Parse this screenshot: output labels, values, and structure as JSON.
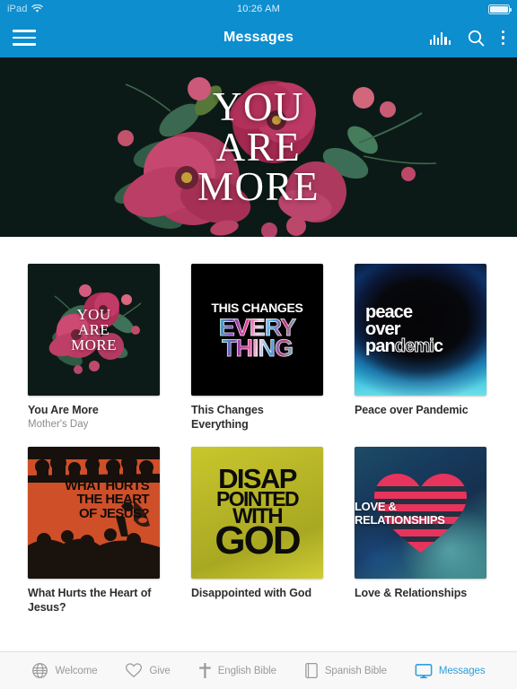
{
  "statusbar": {
    "device": "iPad",
    "wifi_icon": "wifi-icon",
    "time": "10:26 AM",
    "battery_icon": "battery-full-icon"
  },
  "navbar": {
    "menu_icon": "hamburger-menu-icon",
    "title": "Messages",
    "actions": [
      {
        "name": "audio-equalizer-icon",
        "label": "Audio"
      },
      {
        "name": "search-icon",
        "label": "Search"
      },
      {
        "name": "overflow-menu-icon",
        "label": "More"
      }
    ]
  },
  "hero": {
    "line1": "YOU",
    "line2": "ARE",
    "line3": "MORE",
    "background_color": "#0d1b18",
    "accent_color": "#c42a63"
  },
  "series": [
    {
      "title": "You Are More",
      "subtitle": "Mother's Day",
      "art": {
        "line1": "YOU",
        "line2": "ARE",
        "line3": "MORE"
      },
      "background_color": "#0d1b18"
    },
    {
      "title": "This Changes Everything",
      "subtitle": "",
      "art": {
        "line1": "THIS CHANGES",
        "line2": "EVERY",
        "line3": "THING"
      },
      "background_color": "#000000"
    },
    {
      "title": "Peace over Pandemic",
      "subtitle": "",
      "art": {
        "line1": "peace",
        "line2": "over",
        "line3a": "pan",
        "line3b": "demi",
        "line3c": "c"
      },
      "background_color": "#06080c"
    },
    {
      "title": "What Hurts the Heart of Jesus?",
      "subtitle": "",
      "art": {
        "line1": "WHAT HURTS",
        "line2": "THE HEART",
        "line3": "OF JESUS?"
      },
      "background_color": "#d4512a"
    },
    {
      "title": "Disappointed with God",
      "subtitle": "",
      "art": {
        "line1": "DISAP",
        "line2": "POINTED",
        "line3": "WITH",
        "line4": "GOD"
      },
      "background_color": "#b6b427"
    },
    {
      "title": "Love & Relationships",
      "subtitle": "",
      "art": {
        "line1": "LOVE & RELATIONSHIPS"
      },
      "background_color": "#1d4b66"
    }
  ],
  "tabbar": {
    "active_color": "#2b9fe0",
    "inactive_color": "#9a9a9a",
    "tabs": [
      {
        "label": "Welcome",
        "icon": "globe-icon",
        "active": false
      },
      {
        "label": "Give",
        "icon": "heart-icon",
        "active": false
      },
      {
        "label": "English Bible",
        "icon": "cross-icon",
        "active": false
      },
      {
        "label": "Spanish Bible",
        "icon": "book-icon",
        "active": false
      },
      {
        "label": "Messages",
        "icon": "monitor-icon",
        "active": true
      }
    ]
  }
}
